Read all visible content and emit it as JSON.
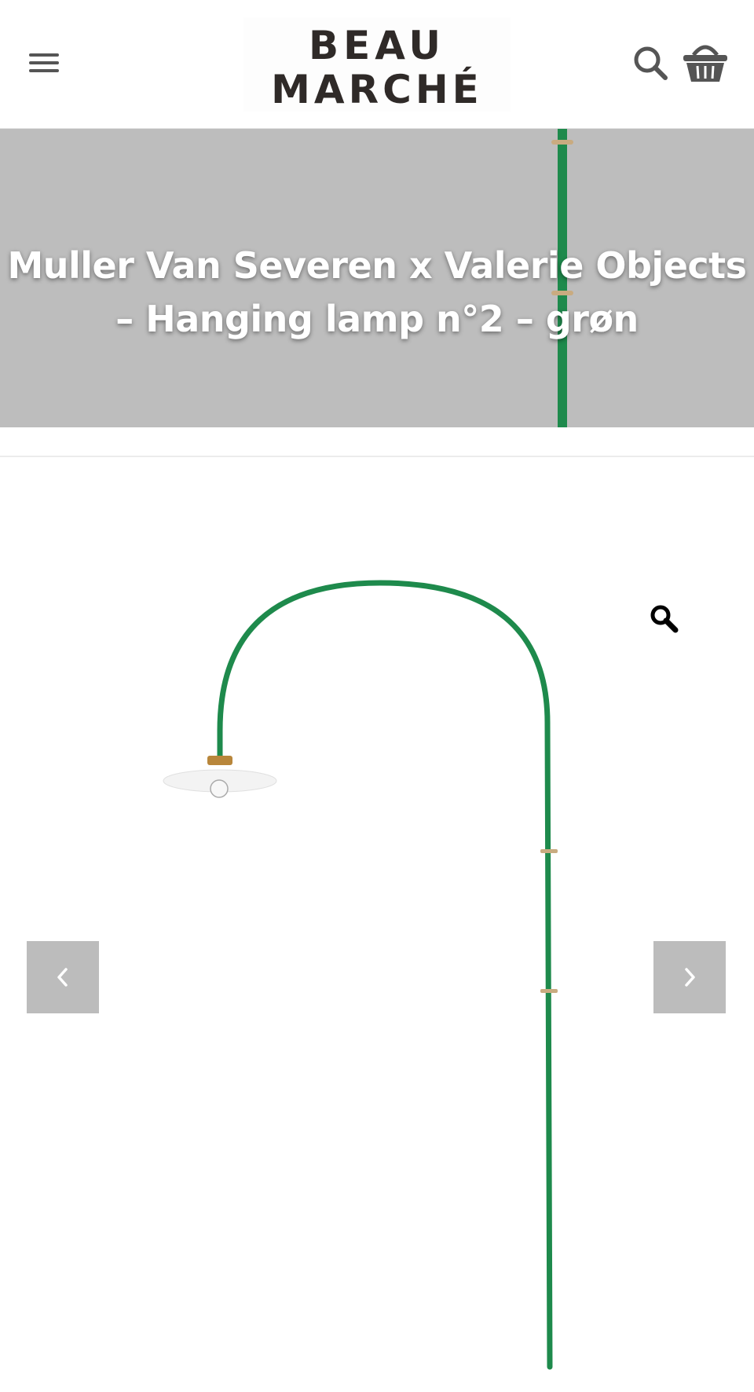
{
  "header": {
    "logo_line1": "BEAU",
    "logo_line2": "MARCHÉ",
    "menu_icon": "hamburger-menu-icon",
    "search_icon": "search-icon",
    "cart_icon": "shopping-basket-icon"
  },
  "hero": {
    "title_line1": "Muller Van Severen x Valerie Objects",
    "title_line2": "– Hanging lamp n°2 – grøn",
    "background_color": "#bdbdbd"
  },
  "gallery": {
    "zoom_icon": "magnifier-zoom-icon",
    "prev_icon": "chevron-left-icon",
    "next_icon": "chevron-right-icon",
    "lamp_color": "#1e8a4c",
    "accent_brass": "#c9ab80"
  }
}
